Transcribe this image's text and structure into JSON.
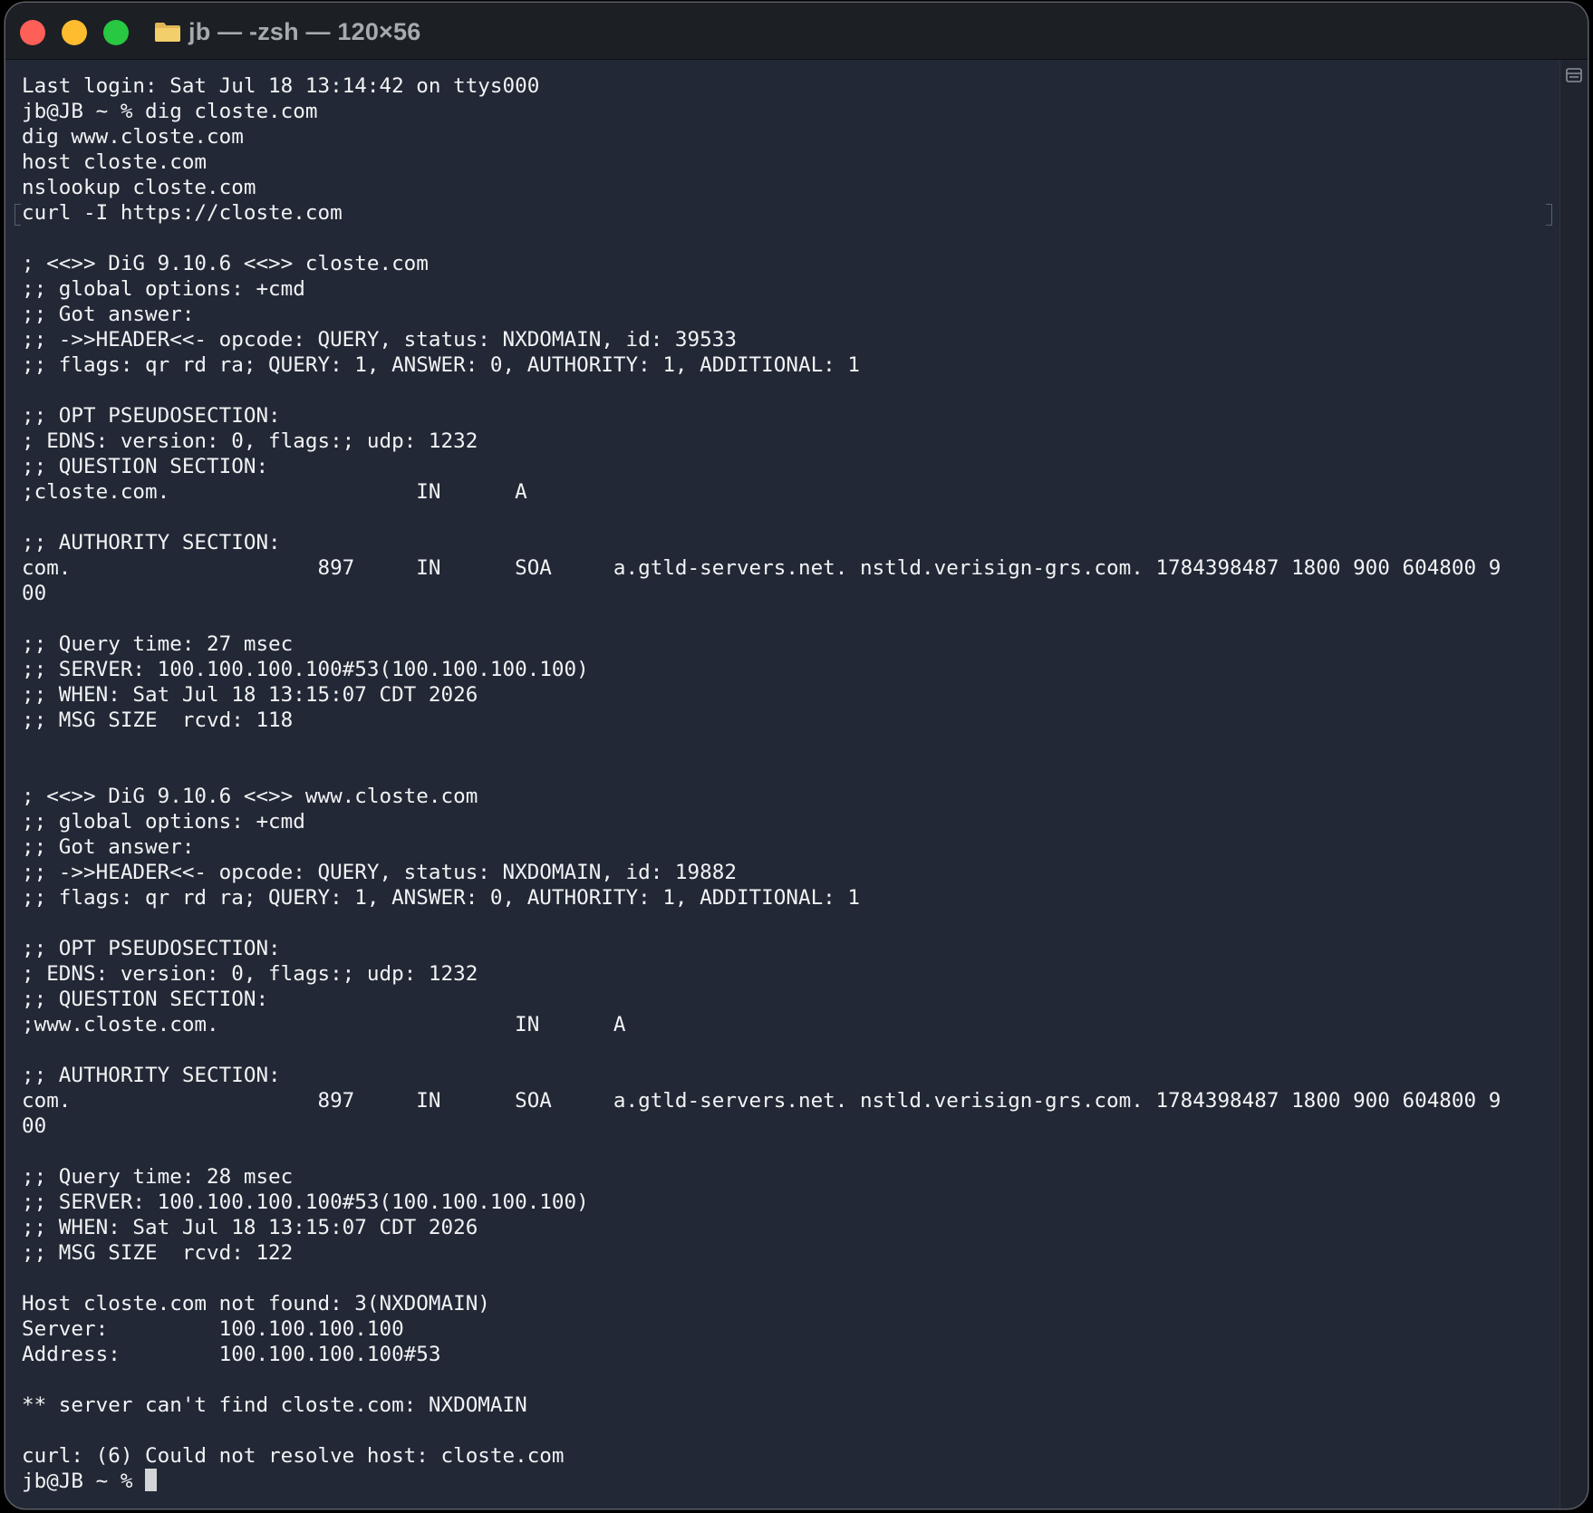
{
  "window": {
    "title": "jb — -zsh — 120×56"
  },
  "colors": {
    "background": "#222835",
    "text": "#f2f3f5",
    "titlebar": "#1c1f24",
    "close": "#fe5f57",
    "minimize": "#febc2e",
    "maximize": "#28c840"
  },
  "icons": {
    "title": "folder-icon",
    "scroll": "split-pane-icon"
  },
  "terminal": {
    "output": "Last login: Sat Jul 18 13:14:42 on ttys000\njb@JB ~ % dig closte.com\ndig www.closte.com\nhost closte.com\nnslookup closte.com\ncurl -I https://closte.com\n\n; <<>> DiG 9.10.6 <<>> closte.com\n;; global options: +cmd\n;; Got answer:\n;; ->>HEADER<<- opcode: QUERY, status: NXDOMAIN, id: 39533\n;; flags: qr rd ra; QUERY: 1, ANSWER: 0, AUTHORITY: 1, ADDITIONAL: 1\n\n;; OPT PSEUDOSECTION:\n; EDNS: version: 0, flags:; udp: 1232\n;; QUESTION SECTION:\n;closte.com.                    IN      A\n\n;; AUTHORITY SECTION:\ncom.                    897     IN      SOA     a.gtld-servers.net. nstld.verisign-grs.com. 1784398487 1800 900 604800 9\n00\n\n;; Query time: 27 msec\n;; SERVER: 100.100.100.100#53(100.100.100.100)\n;; WHEN: Sat Jul 18 13:15:07 CDT 2026\n;; MSG SIZE  rcvd: 118\n\n\n; <<>> DiG 9.10.6 <<>> www.closte.com\n;; global options: +cmd\n;; Got answer:\n;; ->>HEADER<<- opcode: QUERY, status: NXDOMAIN, id: 19882\n;; flags: qr rd ra; QUERY: 1, ANSWER: 0, AUTHORITY: 1, ADDITIONAL: 1\n\n;; OPT PSEUDOSECTION:\n; EDNS: version: 0, flags:; udp: 1232\n;; QUESTION SECTION:\n;www.closte.com.                        IN      A\n\n;; AUTHORITY SECTION:\ncom.                    897     IN      SOA     a.gtld-servers.net. nstld.verisign-grs.com. 1784398487 1800 900 604800 9\n00\n\n;; Query time: 28 msec\n;; SERVER: 100.100.100.100#53(100.100.100.100)\n;; WHEN: Sat Jul 18 13:15:07 CDT 2026\n;; MSG SIZE  rcvd: 122\n\nHost closte.com not found: 3(NXDOMAIN)\nServer:         100.100.100.100\nAddress:        100.100.100.100#53\n\n** server can't find closte.com: NXDOMAIN\n\ncurl: (6) Could not resolve host: closte.com\n",
    "prompt": "jb@JB ~ % "
  }
}
